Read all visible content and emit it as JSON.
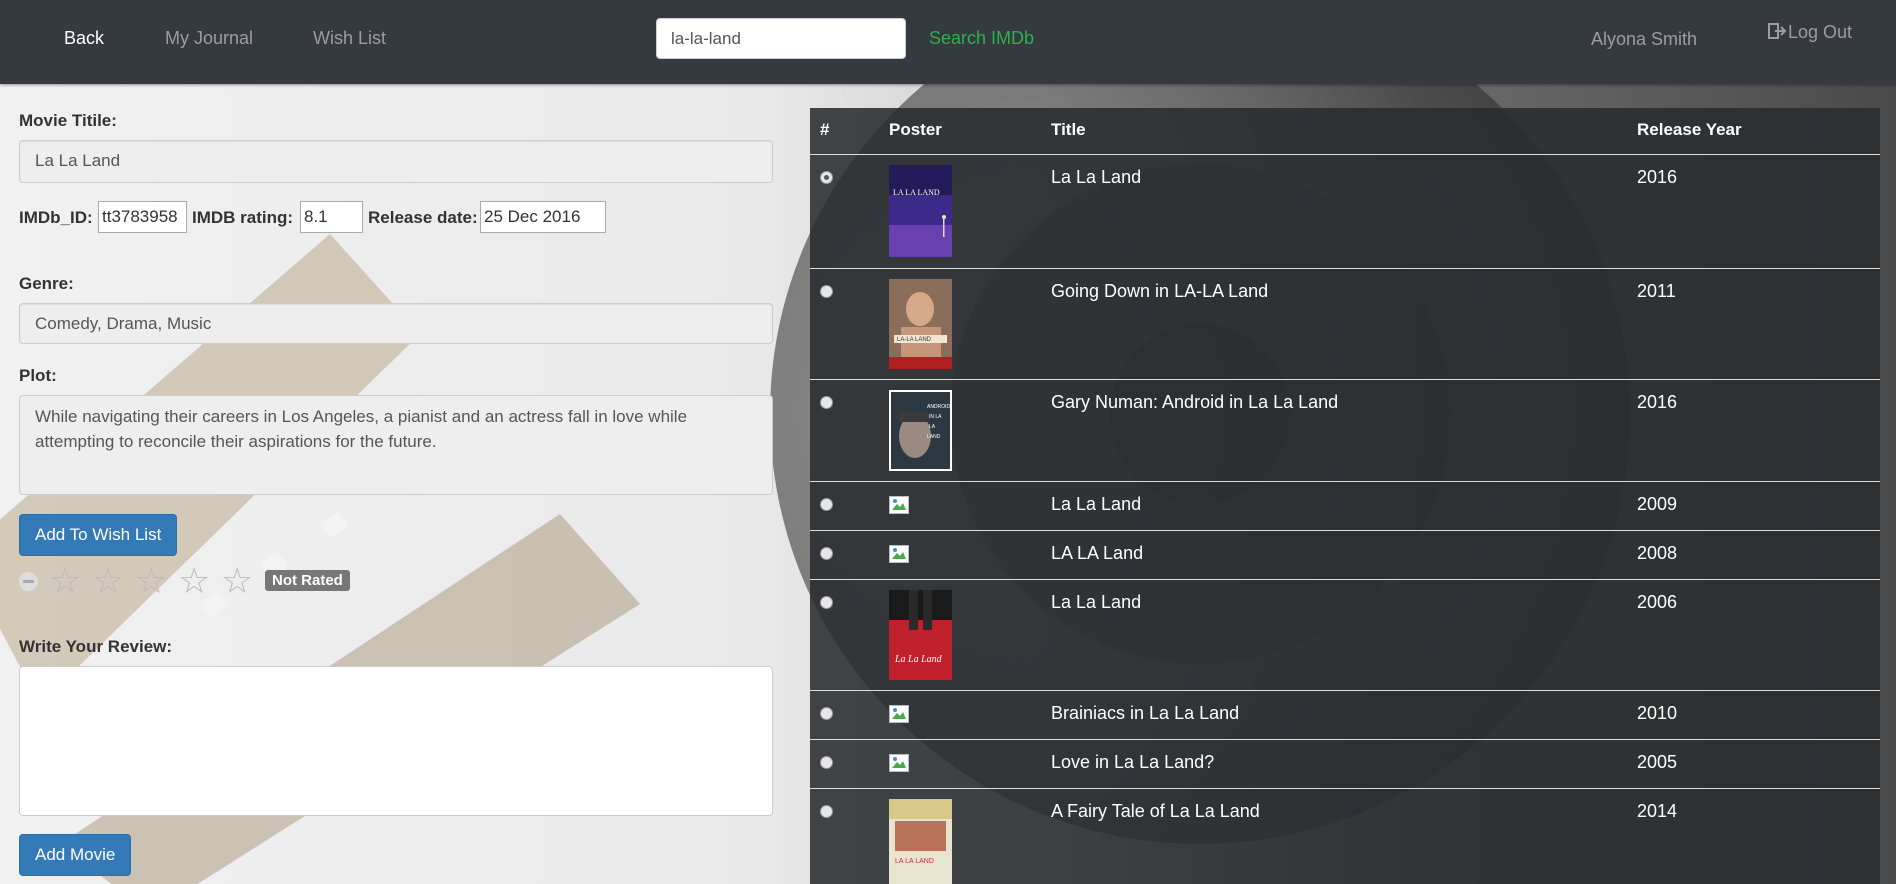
{
  "nav": {
    "back": "Back",
    "journal": "My Journal",
    "wishlist": "Wish List",
    "search_value": "la-la-land",
    "search_button": "Search IMDb",
    "user": "Alyona Smith",
    "logout": "Log Out"
  },
  "form": {
    "title_label": "Movie Titile:",
    "title_value": "La La Land",
    "imdb_id_label": "IMDb_ID:",
    "imdb_id_value": "tt3783958",
    "imdb_rating_label": "IMDB rating:",
    "imdb_rating_value": "8.1",
    "release_label": "Release date:",
    "release_value": "25 Dec 2016",
    "genre_label": "Genre:",
    "genre_value": "Comedy, Drama, Music",
    "plot_label": "Plot:",
    "plot_value": "While navigating their careers in Los Angeles, a pianist and an actress fall in love while attempting to reconcile their aspirations for the future.",
    "wishlist_button": "Add To Wish List",
    "rating_badge": "Not Rated",
    "review_label": "Write Your Review:",
    "review_value": "",
    "add_movie_button": "Add Movie"
  },
  "results": {
    "headers": [
      "#",
      "Poster",
      "Title",
      "Release Year"
    ],
    "rows": [
      {
        "title": "La La Land",
        "year": "2016",
        "selected": true,
        "poster": "lalaland-2016"
      },
      {
        "title": "Going Down in LA-LA Land",
        "year": "2011",
        "selected": false,
        "poster": "going-down"
      },
      {
        "title": "Gary Numan: Android in La La Land",
        "year": "2016",
        "selected": false,
        "poster": "gary-numan"
      },
      {
        "title": "La La Land",
        "year": "2009",
        "selected": false,
        "poster": "broken-image"
      },
      {
        "title": "LA LA Land",
        "year": "2008",
        "selected": false,
        "poster": "broken-image"
      },
      {
        "title": "La La Land",
        "year": "2006",
        "selected": false,
        "poster": "lalaland-2006"
      },
      {
        "title": "Brainiacs in La La Land",
        "year": "2010",
        "selected": false,
        "poster": "broken-image"
      },
      {
        "title": "Love in La La Land?",
        "year": "2005",
        "selected": false,
        "poster": "broken-image"
      },
      {
        "title": "A Fairy Tale of La La Land",
        "year": "2014",
        "selected": false,
        "poster": "fairy-tale"
      }
    ]
  },
  "colors": {
    "navbar": "#343a40",
    "primary": "#337ab7",
    "search_accent": "#2cb24a",
    "badge": "#777777"
  }
}
